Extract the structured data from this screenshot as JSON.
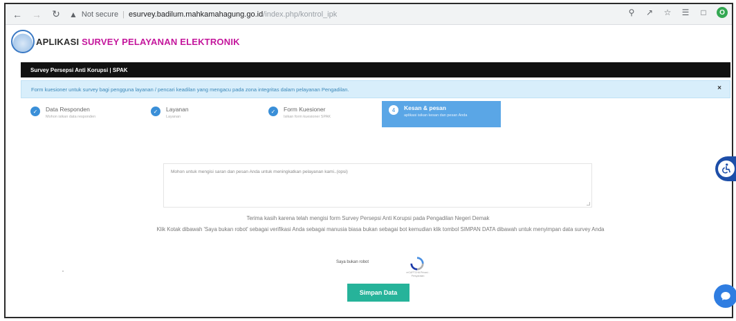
{
  "browser": {
    "security": "Not secure",
    "url_host": "esurvey.badilum.mahkamahagung.go.id",
    "url_path": "/index.php/kontrol_ipk",
    "profile_initial": "O"
  },
  "app": {
    "title_part1": "APLIKASI",
    "title_part2": "SURVEY PELAYANAN ELEKTRONIK"
  },
  "section_title": "Survey Persepsi Anti Korupsi | SPAK",
  "alert": "Form kuesioner untuk survey bagi pengguna layanan / pencari keadilan yang mengacu pada zona integritas dalam pelayanan Pengadilan.",
  "steps": [
    {
      "label": "Data Responden",
      "sub": "Mohon isikan data responden"
    },
    {
      "label": "Layanan",
      "sub": "Layanan"
    },
    {
      "label": "Form Kuesioner",
      "sub": "Isikan form kuesioner SPAK"
    },
    {
      "label": "Kesan & pesan",
      "sub": "aplikasi isikan kesan dan pesan Anda",
      "number": "4"
    }
  ],
  "textarea_placeholder": "Mohon untuk mengisi saran dan pesan Anda untuk meningkatkan pelayanan kami..(opsi)",
  "thanks_text": "Terima kasih karena telah mengisi form Survey Persepsi Anti Korupsi pada Pengadilan Negeri Demak",
  "instruction_text": "Klik Kotak dibawah 'Saya bukan robot' sebagai verifikasi Anda sebagai manusia biasa bukan sebagai bot kemudian klik tombol SIMPAN DATA dibawah untuk menyimpan data survey Anda",
  "captcha": {
    "label": "Saya bukan robot",
    "sub": "reCAPTCHA Privasi - Persyaratan"
  },
  "save_label": "Simpan Data",
  "colors": {
    "accent": "#c4169c",
    "step_active": "#5aa6e6",
    "save_button": "#26b39a",
    "alert_bg": "#d8eefb"
  }
}
